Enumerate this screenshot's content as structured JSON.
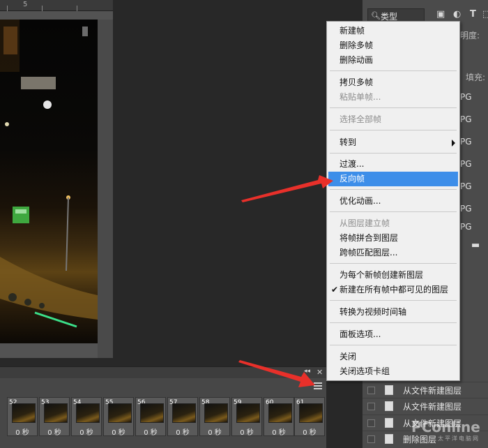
{
  "ruler": {
    "mark": "5"
  },
  "timeline": {
    "frames": [
      {
        "num": "52",
        "dur": "0 秒"
      },
      {
        "num": "53",
        "dur": "0 秒"
      },
      {
        "num": "54",
        "dur": "0 秒"
      },
      {
        "num": "55",
        "dur": "0 秒"
      },
      {
        "num": "56",
        "dur": "0 秒"
      },
      {
        "num": "57",
        "dur": "0 秒"
      },
      {
        "num": "58",
        "dur": "0 秒"
      },
      {
        "num": "59",
        "dur": "0 秒"
      },
      {
        "num": "60",
        "dur": "0 秒"
      },
      {
        "num": "61",
        "dur": "0 秒"
      }
    ],
    "collapse_glyph": "◂◂",
    "close_glyph": "✕"
  },
  "layers_panel": {
    "filter_label": "类型",
    "opacity_label": "透明度:",
    "fill_label": "填充:",
    "jpg_labels": [
      "PG",
      "PG",
      "PG",
      "PG",
      "PG",
      "PG",
      "PG"
    ],
    "rows": [
      {
        "name": "从文件新建图层"
      },
      {
        "name": "从文件新建图层"
      },
      {
        "name": "从文件新建图层"
      },
      {
        "name": "删除图层"
      }
    ]
  },
  "menu": {
    "items": [
      {
        "label": "新建帧",
        "disabled": false
      },
      {
        "label": "删除多帧",
        "disabled": false
      },
      {
        "label": "删除动画",
        "disabled": false
      },
      {
        "label": "拷贝多帧",
        "disabled": false
      },
      {
        "label": "粘贴单帧...",
        "disabled": true
      },
      {
        "label": "选择全部帧",
        "disabled": true
      },
      {
        "label": "转到",
        "disabled": false,
        "submenu": true
      },
      {
        "label": "过渡...",
        "disabled": false
      },
      {
        "label": "反向帧",
        "disabled": false,
        "highlighted": true
      },
      {
        "label": "优化动画...",
        "disabled": false
      },
      {
        "label": "从图层建立帧",
        "disabled": true
      },
      {
        "label": "将帧拼合到图层",
        "disabled": false
      },
      {
        "label": "跨帧匹配图层...",
        "disabled": false
      },
      {
        "label": "为每个新帧创建新图层",
        "disabled": false
      },
      {
        "label": "新建在所有帧中都可见的图层",
        "disabled": false,
        "checked": true
      },
      {
        "label": "转换为视频时间轴",
        "disabled": false
      },
      {
        "label": "面板选项...",
        "disabled": false
      },
      {
        "label": "关闭",
        "disabled": false
      },
      {
        "label": "关闭选项卡组",
        "disabled": false
      }
    ],
    "check_glyph": "✔",
    "highlight_color": "#3d8ee9"
  },
  "watermark": {
    "brand": "PConline",
    "sub": "太平洋电脑网"
  },
  "colors": {
    "arrow": "#e8302a"
  }
}
